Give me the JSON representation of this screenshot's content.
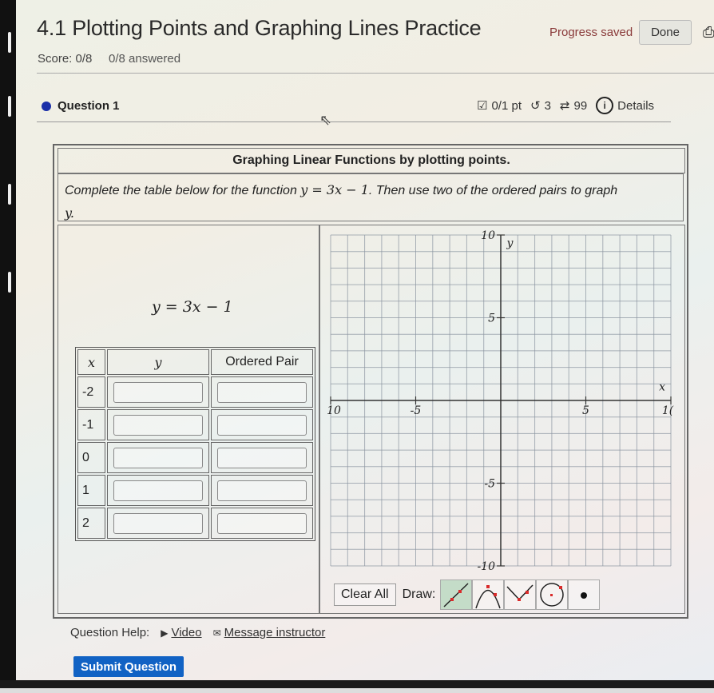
{
  "header": {
    "title": "4.1 Plotting Points and Graphing Lines Practice",
    "progress_status": "Progress saved",
    "done_label": "Done",
    "score": "Score: 0/8",
    "answered": "0/8 answered"
  },
  "question": {
    "label": "Question 1",
    "points": "0/1 pt",
    "retries": "3",
    "attempts": "99",
    "details_label": "Details"
  },
  "problem": {
    "heading": "Graphing Linear Functions by plotting points.",
    "instruction_before": "Complete the table below for the function ",
    "instruction_math": "y = 3x − 1",
    "instruction_after": ". Then use two of the ordered pairs to graph",
    "instruction_tail": "y.",
    "equation": "y = 3x − 1"
  },
  "table": {
    "headers": [
      "x",
      "y",
      "Ordered Pair"
    ],
    "rows": [
      {
        "x": "-2",
        "y": "",
        "pair": ""
      },
      {
        "x": "-1",
        "y": "",
        "pair": ""
      },
      {
        "x": "0",
        "y": "",
        "pair": ""
      },
      {
        "x": "1",
        "y": "",
        "pair": ""
      },
      {
        "x": "2",
        "y": "",
        "pair": ""
      }
    ]
  },
  "graph": {
    "x_axis_label": "x",
    "y_axis_label": "y",
    "xmin": -10,
    "xmax": 10,
    "ymin": -10,
    "ymax": 10,
    "grid_step": 1,
    "x_tick_labels": [
      "10",
      "-5",
      "5",
      "1("
    ],
    "y_tick_labels": [
      "10",
      "5",
      "-5",
      "-10"
    ]
  },
  "toolbar": {
    "clear_label": "Clear All",
    "draw_label": "Draw:",
    "tools": [
      "line-tool",
      "parabola-tool",
      "absolute-value-tool",
      "circle-tool",
      "point-tool"
    ],
    "active_tool": "line-tool"
  },
  "help": {
    "label": "Question Help:",
    "video_label": "Video",
    "message_label": "Message instructor"
  },
  "submit_label": "Submit Question",
  "colors": {
    "accent": "#1162c4",
    "question_dot": "#1b2fa8",
    "progress_text": "#8a3a3a",
    "tool_point": "#d92b2b"
  }
}
